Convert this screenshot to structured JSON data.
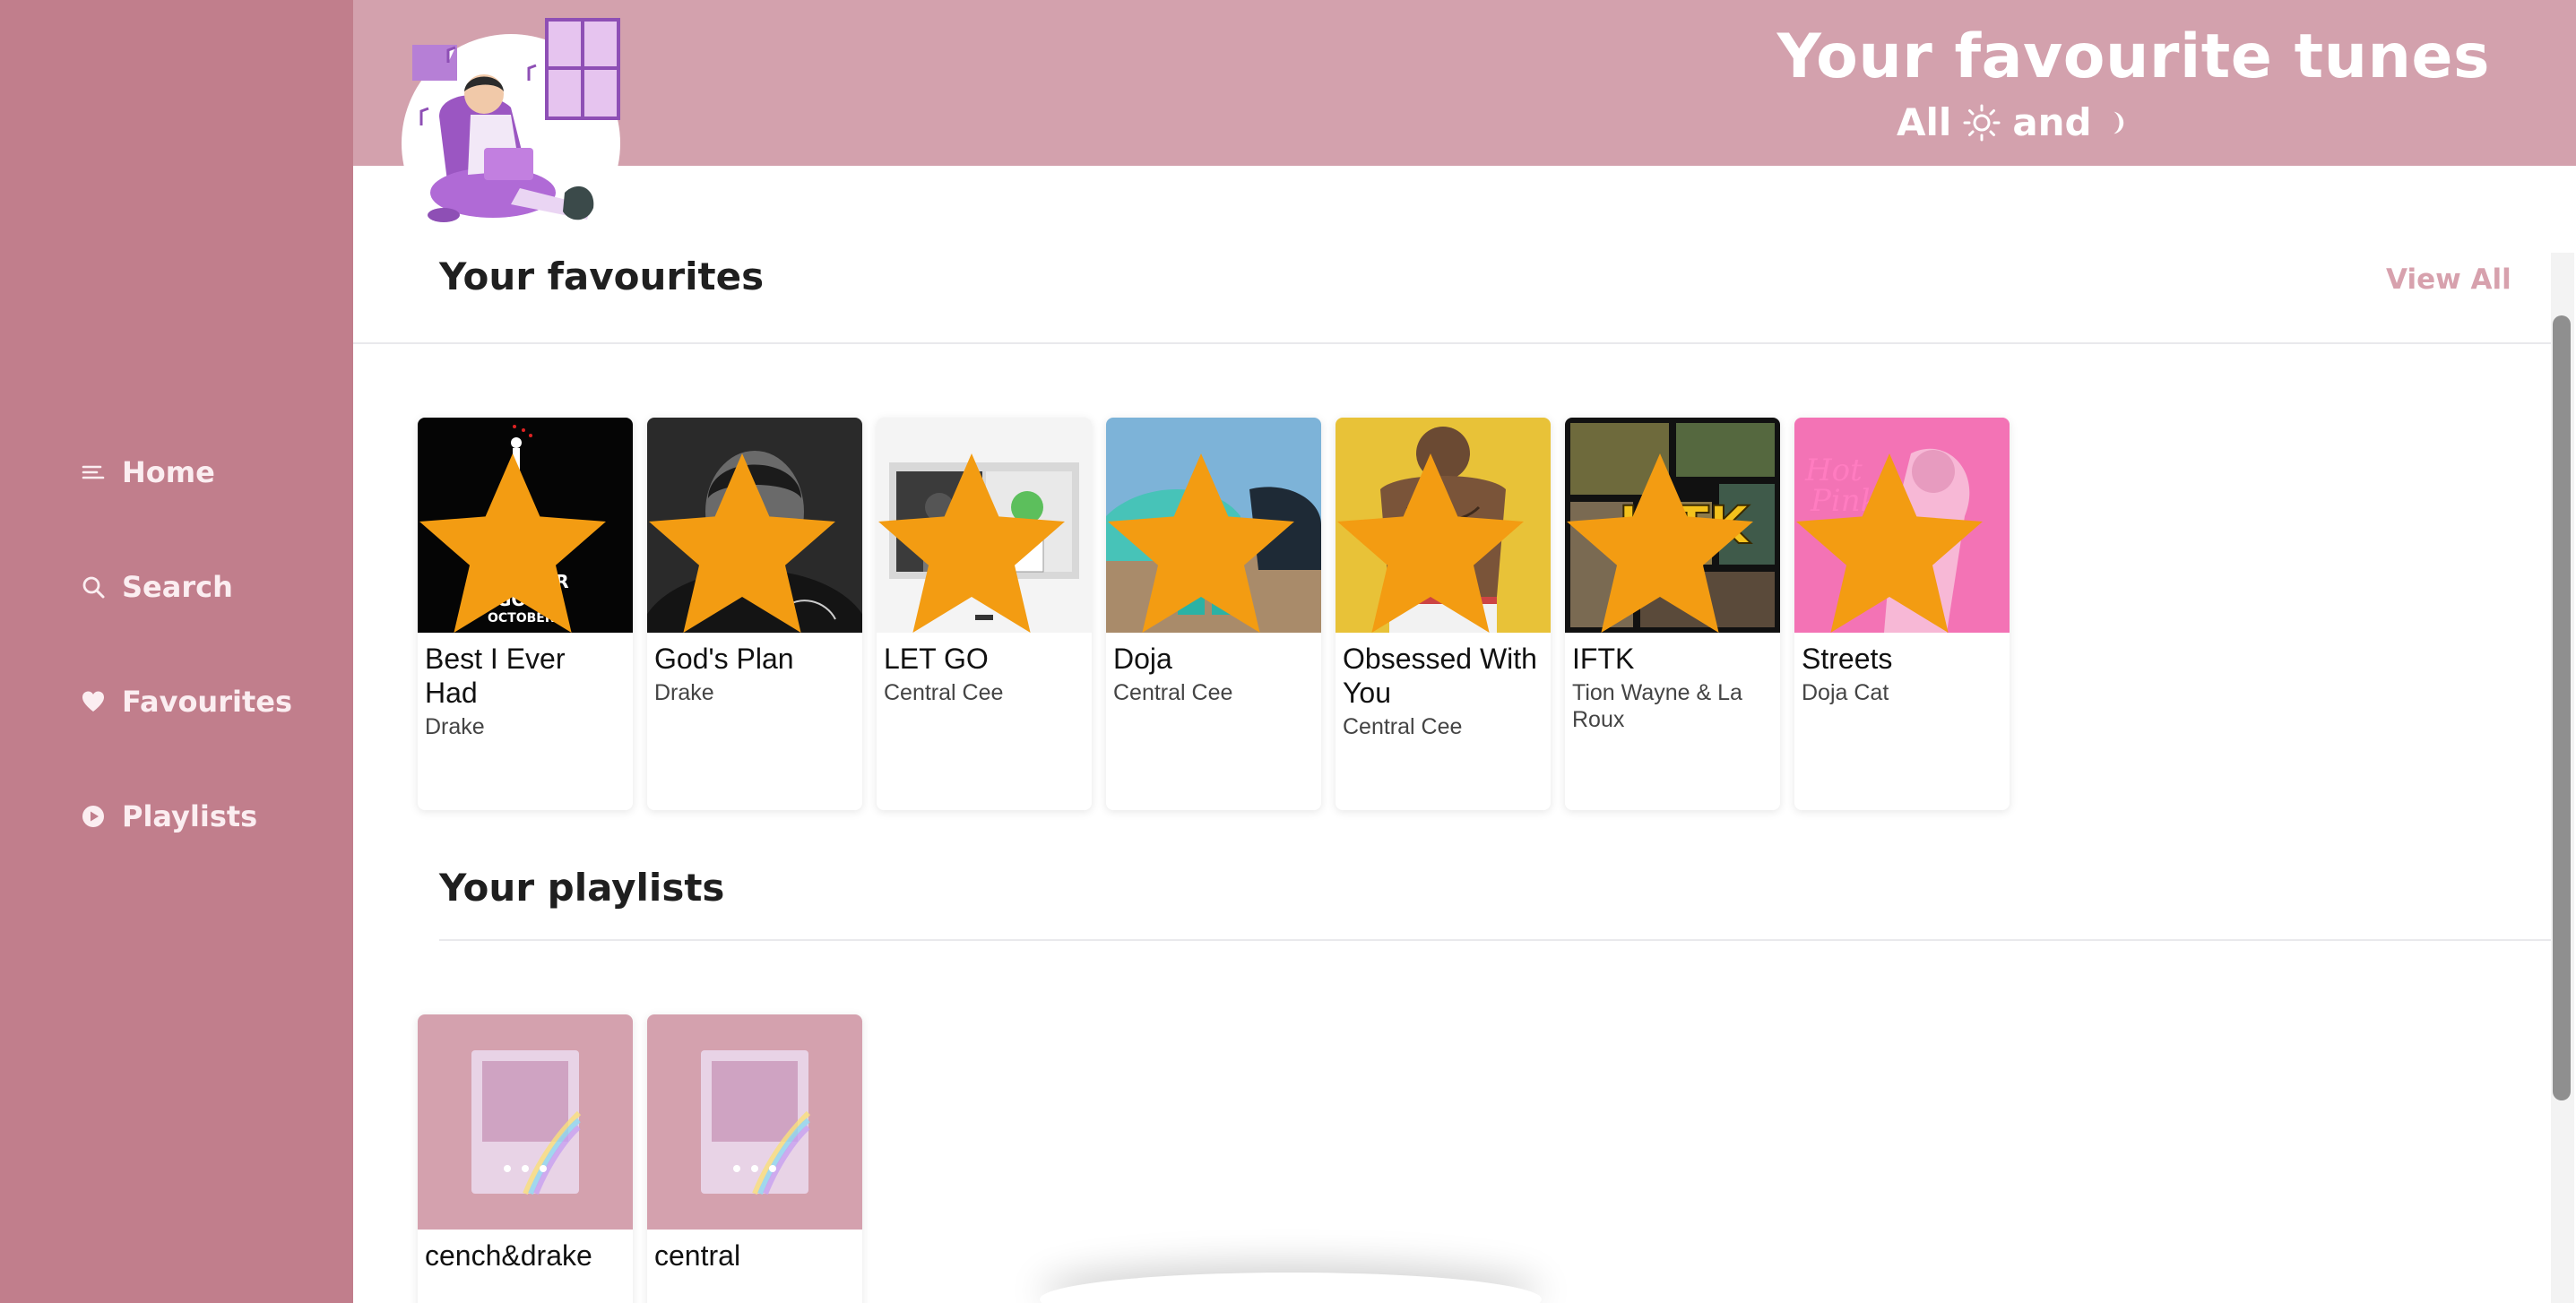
{
  "sidebar": {
    "items": [
      {
        "label": "Home",
        "icon": "menu-lines-icon"
      },
      {
        "label": "Search",
        "icon": "search-icon"
      },
      {
        "label": "Favourites",
        "icon": "heart-icon"
      },
      {
        "label": "Playlists",
        "icon": "play-circle-icon"
      }
    ]
  },
  "header": {
    "title": "Your favourite tunes",
    "subtitle_all": "All",
    "subtitle_and": "and",
    "sun_icon": "sun-icon",
    "moon_icon": "moon-icon"
  },
  "favourites": {
    "title": "Your favourites",
    "view_all": "View All",
    "items": [
      {
        "title": "Best I Ever Had",
        "artist": "Drake"
      },
      {
        "title": "God's Plan",
        "artist": "Drake"
      },
      {
        "title": "LET GO",
        "artist": "Central Cee"
      },
      {
        "title": "Doja",
        "artist": "Central Cee"
      },
      {
        "title": "Obsessed With You",
        "artist": "Central Cee"
      },
      {
        "title": "IFTK",
        "artist": "Tion Wayne & La Roux"
      },
      {
        "title": "Streets",
        "artist": "Doja Cat"
      }
    ]
  },
  "playlists": {
    "title": "Your playlists",
    "items": [
      {
        "title": "cench&drake"
      },
      {
        "title": "central"
      }
    ]
  },
  "colors": {
    "sidebar": "#c17e8c",
    "header": "#d3a1ad",
    "accent_star": "#f39c12",
    "view_all": "#d7a1ad"
  }
}
